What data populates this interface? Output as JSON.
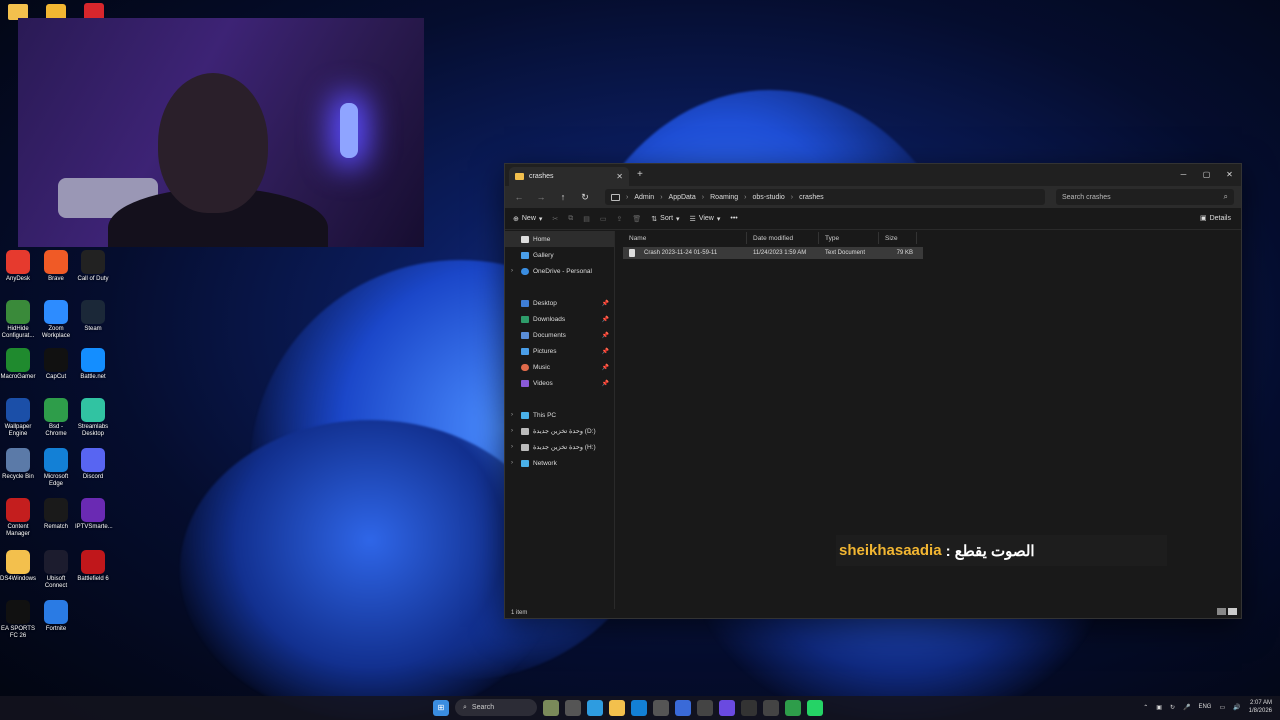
{
  "desktop": {
    "icons": [
      {
        "label": "AnyDesk",
        "icon": "anydesk-icon",
        "color": "#e63a2e"
      },
      {
        "label": "Brave",
        "icon": "brave-icon",
        "color": "#f05a26"
      },
      {
        "label": "Call of Duty",
        "icon": "cod-icon",
        "color": "#222222"
      },
      {
        "label": "HidHide Configurat...",
        "icon": "hidhide-icon",
        "color": "#3a8a3a"
      },
      {
        "label": "Zoom Workplace",
        "icon": "zoom-icon",
        "color": "#2d8cff"
      },
      {
        "label": "Steam",
        "icon": "steam-icon",
        "color": "#1b2838"
      },
      {
        "label": "MacroGamer",
        "icon": "macrogamer-icon",
        "color": "#1f8a2e"
      },
      {
        "label": "CapCut",
        "icon": "capcut-icon",
        "color": "#111111"
      },
      {
        "label": "Battle.net",
        "icon": "battlenet-icon",
        "color": "#148eff"
      },
      {
        "label": "Wallpaper Engine",
        "icon": "wallpaper-engine-icon",
        "color": "#1b4fa8"
      },
      {
        "label": "Bsd - Chrome",
        "icon": "chrome-icon",
        "color": "#2e9d4a"
      },
      {
        "label": "Streamlabs Desktop",
        "icon": "streamlabs-icon",
        "color": "#31c3a2"
      },
      {
        "label": "Recycle Bin",
        "icon": "recycle-bin-icon",
        "color": "#5b7aa8"
      },
      {
        "label": "Microsoft Edge",
        "icon": "edge-icon",
        "color": "#1380d6"
      },
      {
        "label": "Discord",
        "icon": "discord-icon",
        "color": "#5865f2"
      },
      {
        "label": "Content Manager",
        "icon": "content-manager-icon",
        "color": "#c41e1e"
      },
      {
        "label": "Rematch",
        "icon": "rematch-icon",
        "color": "#1a1a1a"
      },
      {
        "label": "IPTVSmarte...",
        "icon": "iptv-icon",
        "color": "#6a2ab3"
      },
      {
        "label": "DS4Windows",
        "icon": "folder-icon",
        "color": "#f3c04d"
      },
      {
        "label": "Ubisoft Connect",
        "icon": "ubisoft-icon",
        "color": "#1c1c2e"
      },
      {
        "label": "Battlefield 6",
        "icon": "battlefield-icon",
        "color": "#c0171b"
      },
      {
        "label": "EA SPORTS FC 26",
        "icon": "easports-icon",
        "color": "#111111"
      },
      {
        "label": "Fortnite",
        "icon": "fortnite-icon",
        "color": "#2a7be4"
      }
    ]
  },
  "explorer": {
    "tab_title": "crashes",
    "breadcrumbs": [
      "Admin",
      "AppData",
      "Roaming",
      "obs-studio",
      "crashes"
    ],
    "search_placeholder": "Search crashes",
    "commands": {
      "new": "New",
      "sort": "Sort",
      "view": "View",
      "more": "•••",
      "details": "Details"
    },
    "nav": {
      "home": "Home",
      "gallery": "Gallery",
      "onedrive": "OneDrive - Personal",
      "desktop": "Desktop",
      "downloads": "Downloads",
      "documents": "Documents",
      "pictures": "Pictures",
      "music": "Music",
      "videos": "Videos",
      "thispc": "This PC",
      "drive_d": "وحدة تخزين جديدة (D:)",
      "drive_h": "وحدة تخزين جديدة (H:)",
      "network": "Network"
    },
    "columns": {
      "name": "Name",
      "date": "Date modified",
      "type": "Type",
      "size": "Size"
    },
    "files": [
      {
        "name": "Crash 2023-11-24 01-59-11",
        "date": "11/24/2023 1:59 AM",
        "type": "Text Document",
        "size": "79 KB"
      }
    ],
    "status": "1 item"
  },
  "caption": {
    "user": "sheikhasaadia",
    "message": ": الصوت يقطع"
  },
  "taskbar": {
    "search": "Search",
    "lang": "ENG",
    "time": "2:07 AM",
    "date": "1/8/2026"
  }
}
